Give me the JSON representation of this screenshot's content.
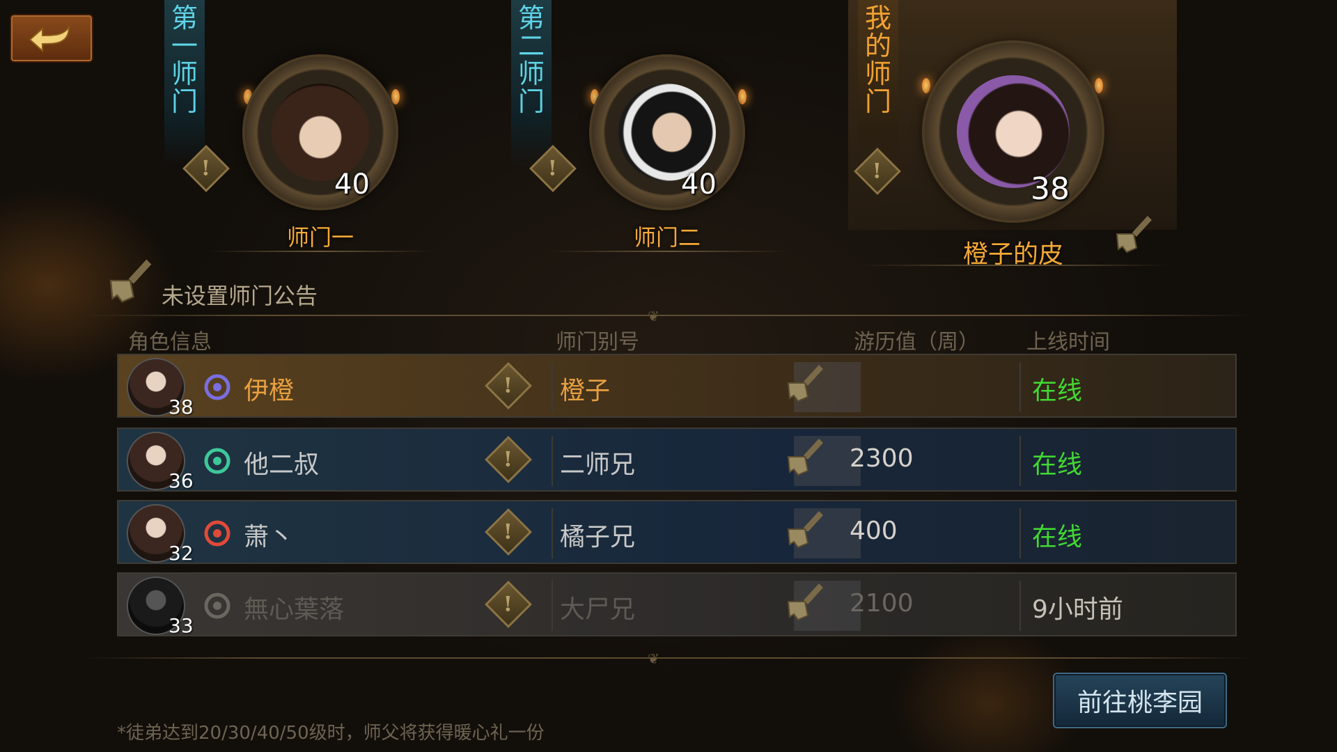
{
  "banners": {
    "first": [
      "第",
      "一",
      "师",
      "门"
    ],
    "second": [
      "第",
      "二",
      "师",
      "门"
    ],
    "mine": [
      "我",
      "的",
      "师",
      "门"
    ]
  },
  "sects": [
    {
      "name": "师门一",
      "level": "40"
    },
    {
      "name": "师门二",
      "level": "40"
    },
    {
      "name": "橙子的皮",
      "level": "38"
    }
  ],
  "notice": "未设置师门公告",
  "headers": {
    "role": "角色信息",
    "alias": "师门别号",
    "exp": "游历值（周）",
    "online": "上线时间"
  },
  "members": [
    {
      "level": "38",
      "name": "伊橙",
      "alias": "橙子",
      "exp": "",
      "status": "在线",
      "name_color": "#e8a040",
      "status_color": "#42d832",
      "class_icon": "purple-swirl-icon"
    },
    {
      "level": "36",
      "name": "他二叔",
      "alias": "二师兄",
      "exp": "2300",
      "status": "在线",
      "name_color": "#c8c8c8",
      "status_color": "#42d832",
      "class_icon": "green-tree-icon"
    },
    {
      "level": "32",
      "name": "萧丶",
      "alias": "橘子兄",
      "exp": "400",
      "status": "在线",
      "name_color": "#c8c8c8",
      "status_color": "#42d832",
      "class_icon": "red-bird-icon"
    },
    {
      "level": "33",
      "name": "無心葉落",
      "alias": "大尸兄",
      "exp": "2100",
      "status": "9小时前",
      "name_color": "#5e5a54",
      "status_color": "#c8c2b8",
      "class_icon": "grey-tree-icon"
    }
  ],
  "goto_button": "前往桃李园",
  "footnote": "*徒弟达到20/30/40/50级时，师父将获得暖心礼一份"
}
